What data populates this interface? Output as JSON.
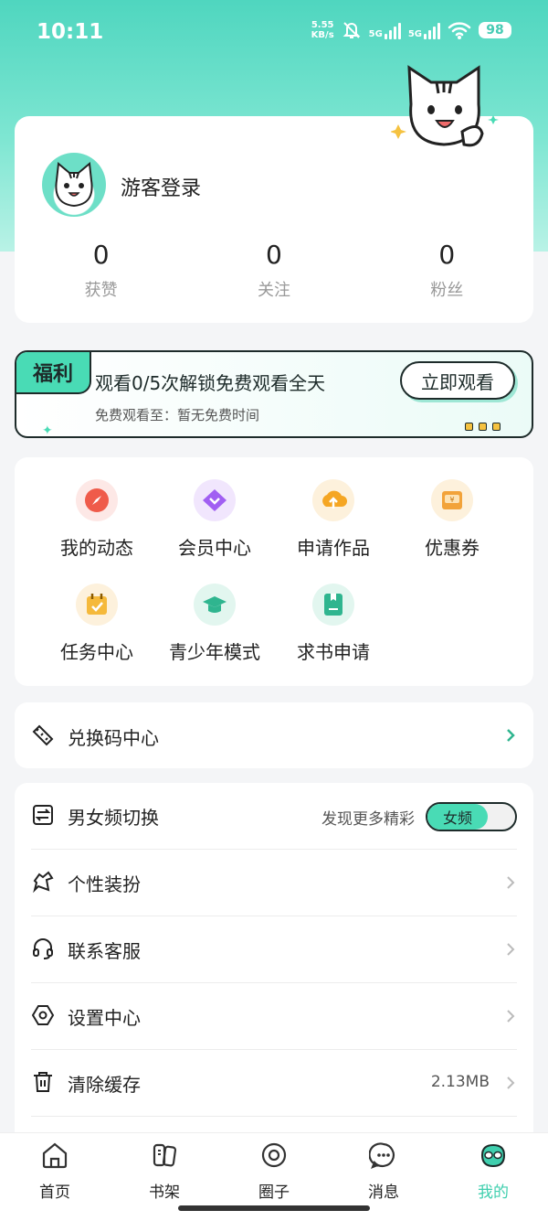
{
  "status_bar": {
    "time": "10:11",
    "net_speed": "5.55",
    "net_unit": "KB/s",
    "sim1": "5G",
    "sim2": "5G",
    "battery": "98"
  },
  "profile": {
    "login_label": "游客登录",
    "stats": [
      {
        "value": "0",
        "label": "获赞"
      },
      {
        "value": "0",
        "label": "关注"
      },
      {
        "value": "0",
        "label": "粉丝"
      }
    ]
  },
  "welfare": {
    "tag": "福利",
    "title": "观看0/5次解锁免费观看全天",
    "subtitle": "免费观看至：暂无免费时间",
    "button": "立即观看"
  },
  "grid": [
    {
      "label": "我的动态",
      "icon": "compass-icon",
      "color": "#ef5b4a",
      "bg": "#fde8e6"
    },
    {
      "label": "会员中心",
      "icon": "vip-diamond-icon",
      "color": "#a15ff2",
      "bg": "#f1e6fd"
    },
    {
      "label": "申请作品",
      "icon": "cloud-upload-icon",
      "color": "#f5a623",
      "bg": "#fdf1dc"
    },
    {
      "label": "优惠券",
      "icon": "coupon-icon",
      "color": "#f2a33a",
      "bg": "#fdf1dc"
    },
    {
      "label": "任务中心",
      "icon": "task-calendar-icon",
      "color": "#f5b93b",
      "bg": "#fdf1dc"
    },
    {
      "label": "青少年模式",
      "icon": "graduation-cap-icon",
      "color": "#2fb58f",
      "bg": "#e2f6ef"
    },
    {
      "label": "求书申请",
      "icon": "book-request-icon",
      "color": "#2fb58f",
      "bg": "#e2f6ef"
    }
  ],
  "redeem": {
    "label": "兑换码中心"
  },
  "settings": [
    {
      "label": "男女频切换",
      "icon": "switch-icon",
      "extra": "发现更多精彩",
      "toggle": "女频"
    },
    {
      "label": "个性装扮",
      "icon": "shirt-icon"
    },
    {
      "label": "联系客服",
      "icon": "headset-icon"
    },
    {
      "label": "设置中心",
      "icon": "settings-hex-icon"
    },
    {
      "label": "清除缓存",
      "icon": "trash-icon",
      "extra": "2.13MB"
    }
  ],
  "tabs": [
    {
      "label": "首页",
      "icon": "home-icon"
    },
    {
      "label": "书架",
      "icon": "bookshelf-icon"
    },
    {
      "label": "圈子",
      "icon": "circle-icon"
    },
    {
      "label": "消息",
      "icon": "message-icon"
    },
    {
      "label": "我的",
      "icon": "profile-cat-icon",
      "active": true
    }
  ],
  "colors": {
    "accent": "#49dbb5",
    "active_tab": "#3fcfae"
  }
}
